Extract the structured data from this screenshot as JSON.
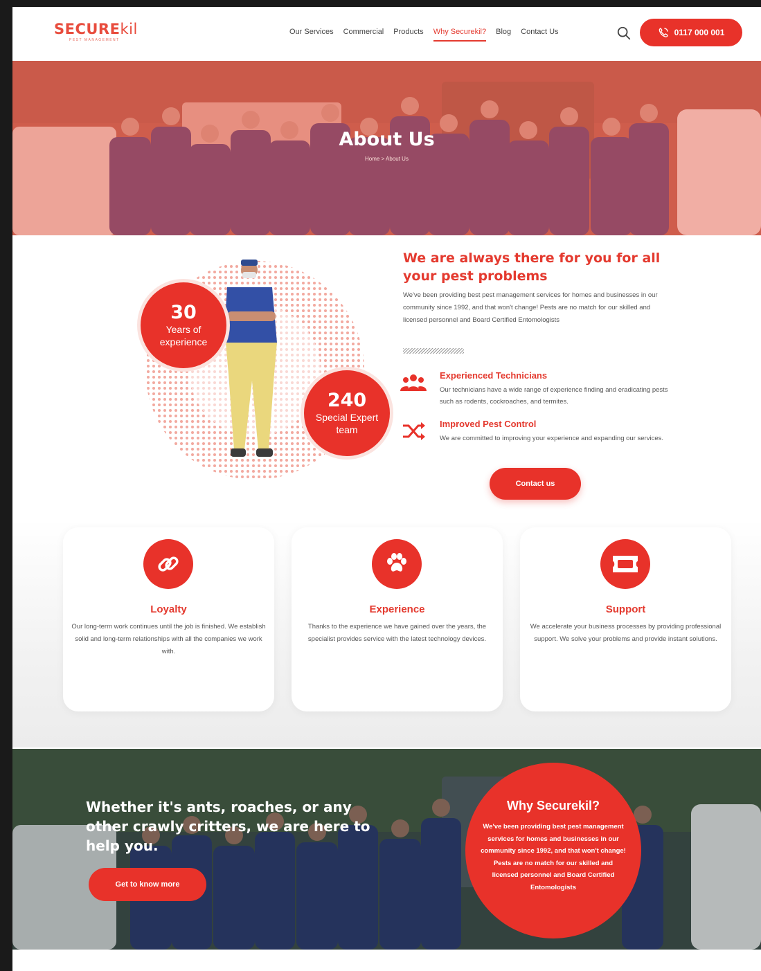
{
  "brand": {
    "name_main": "SECURE",
    "name_accent": "kil",
    "tagline": "PEST MANAGEMENT"
  },
  "nav": {
    "items": [
      {
        "label": "Our Services"
      },
      {
        "label": "Commercial"
      },
      {
        "label": "Products"
      },
      {
        "label": "Why Securekil?"
      },
      {
        "label": "Blog"
      },
      {
        "label": "Contact Us"
      }
    ],
    "active_index": 3,
    "phone_label": "0117 000 001"
  },
  "hero": {
    "title": "About Us",
    "breadcrumb": "Home > About Us"
  },
  "about": {
    "stats": [
      {
        "number": "30",
        "label": "Years of experience"
      },
      {
        "number": "240",
        "label": "Special Expert team"
      }
    ],
    "title": "We are always there for you for all your pest problems",
    "text": "We've been providing best pest management services for homes and businesses in our community since 1992, and that won't change! Pests are no match for our skilled and licensed personnel and Board Certified Entomologists",
    "features": [
      {
        "title": "Experienced Technicians",
        "text": "Our technicians have a wide range of experience finding and eradicating pests such as rodents, cockroaches, and termites.",
        "icon": "team-icon"
      },
      {
        "title": "Improved Pest Control",
        "text": "We are committed to improving your experience and expanding our services.",
        "icon": "shuffle-icon"
      }
    ],
    "cta_label": "Contact us"
  },
  "cards": [
    {
      "title": "Loyalty",
      "text": "Our long-term work continues until the job is finished. We establish solid and long-term relationships with all the companies we work with.",
      "icon": "link-icon"
    },
    {
      "title": "Experience",
      "text": "Thanks to the experience we have gained over the years, the specialist provides service with the latest technology devices.",
      "icon": "paw-icon"
    },
    {
      "title": "Support",
      "text": "We accelerate your business processes by providing professional support. We solve your problems and provide instant solutions.",
      "icon": "ticket-icon"
    }
  ],
  "banner": {
    "headline": "Whether it's ants, roaches, or any other crawly critters, we are here to help you.",
    "button_label": "Get to know more",
    "why_title": "Why Securekil?",
    "why_text": "We've been providing best pest management services for homes and businesses in our community since 1992, and that won't change! Pests are no match for our skilled and licensed personnel and Board Certified Entomologists"
  },
  "colors": {
    "accent": "#e8322a",
    "hero_tint": "#d9705b",
    "text": "#555555"
  }
}
